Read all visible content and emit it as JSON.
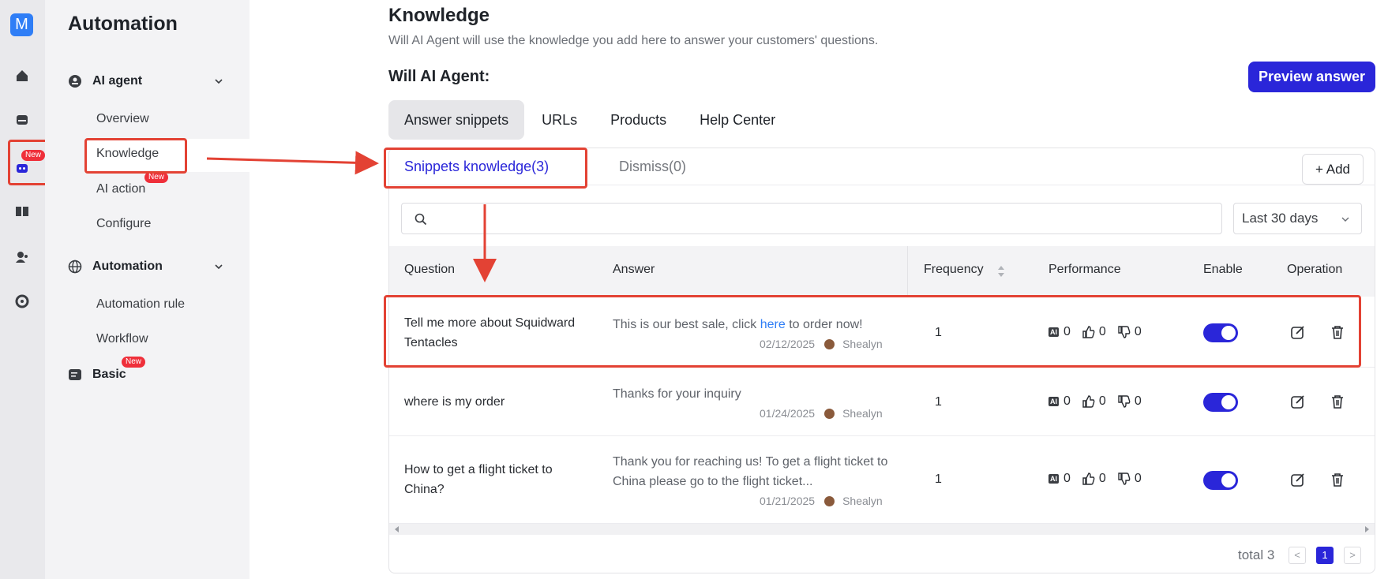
{
  "app": {
    "logo_letter": "M",
    "brand_color": "#2f7ef6",
    "accent_color": "#2a26d9"
  },
  "rail": {
    "icons": [
      "home-icon",
      "inbox-icon",
      "bot-icon",
      "book-icon",
      "contacts-icon",
      "settings-icon"
    ],
    "new_badge": "New"
  },
  "sidebar": {
    "title": "Automation",
    "sections": [
      {
        "label": "AI agent",
        "icon": "robot-icon",
        "items": [
          "Overview",
          "Knowledge",
          "AI action",
          "Configure"
        ]
      },
      {
        "label": "Automation",
        "icon": "globe-icon",
        "items": [
          "Automation rule",
          "Workflow"
        ]
      },
      {
        "label": "Basic",
        "icon": "basic-icon",
        "items": []
      }
    ],
    "ai_action_badge": "New",
    "basic_badge": "New",
    "active_item": "Knowledge"
  },
  "page": {
    "title": "Knowledge",
    "subtitle": "Will AI Agent will use the knowledge you add here to answer your customers' questions.",
    "agent_label": "Will AI Agent:",
    "preview_button": "Preview answer"
  },
  "tabs": [
    "Answer snippets",
    "URLs",
    "Products",
    "Help Center"
  ],
  "subtabs": {
    "active": "Snippets knowledge(3)",
    "inactive": "Dismiss(0)"
  },
  "add_button": "+ Add",
  "search": {
    "placeholder": ""
  },
  "date_filter": "Last 30 days",
  "table": {
    "columns": [
      "Question",
      "Answer",
      "Frequency",
      "Performance",
      "Enable",
      "Operation"
    ],
    "rows": [
      {
        "question": "Tell me more about Squidward Tentacles",
        "answer_pre": "This is our best sale, click ",
        "answer_link": "here",
        "answer_post": " to order now!",
        "date": "02/12/2025",
        "author": "Shealyn",
        "frequency": "1",
        "ai": "0",
        "up": "0",
        "down": "0",
        "enabled": true
      },
      {
        "question": "where is my order",
        "answer": "Thanks for your inquiry",
        "date": "01/24/2025",
        "author": "Shealyn",
        "frequency": "1",
        "ai": "0",
        "up": "0",
        "down": "0",
        "enabled": true
      },
      {
        "question": "How to get a flight ticket to China?",
        "answer": "Thank you for reaching us! To get a flight ticket to China please go to the flight ticket...",
        "date": "01/21/2025",
        "author": "Shealyn",
        "frequency": "1",
        "ai": "0",
        "up": "0",
        "down": "0",
        "enabled": true
      }
    ]
  },
  "pagination": {
    "total_label": "total 3",
    "prev": "<",
    "current": "1",
    "next": ">"
  },
  "ai_tag": "AI"
}
